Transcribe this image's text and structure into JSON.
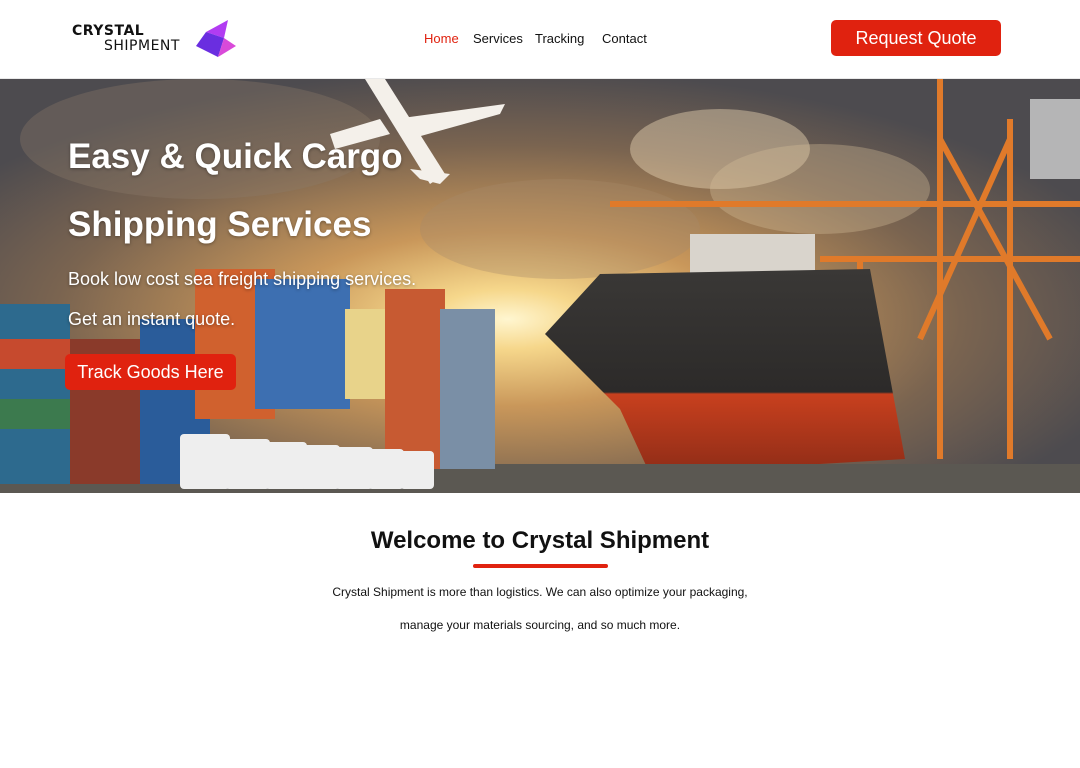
{
  "brand": {
    "name_line1": "CRYSTAL",
    "name_line2": "SHIPMENT",
    "accent_color": "#e0220f",
    "logo_colors": [
      "#6a2ee0",
      "#b23cf2",
      "#d94ad9"
    ]
  },
  "nav": {
    "items": [
      {
        "label": "Home",
        "active": true
      },
      {
        "label": "Services",
        "active": false
      },
      {
        "label": "Tracking",
        "active": false
      },
      {
        "label": "Contact",
        "active": false
      }
    ]
  },
  "header": {
    "cta_label": "Request Quote"
  },
  "hero": {
    "title_line1": "Easy & Quick Cargo",
    "title_line2": "Shipping Services",
    "subtitle_line1": "Book low cost sea freight shipping services.",
    "subtitle_line2": "Get an instant quote.",
    "cta_label": "Track Goods Here"
  },
  "welcome": {
    "title": "Welcome to Crystal Shipment",
    "paragraph_line1": "Crystal Shipment is more than logistics. We can also optimize your packaging,",
    "paragraph_line2": "manage your materials sourcing, and so much more."
  }
}
